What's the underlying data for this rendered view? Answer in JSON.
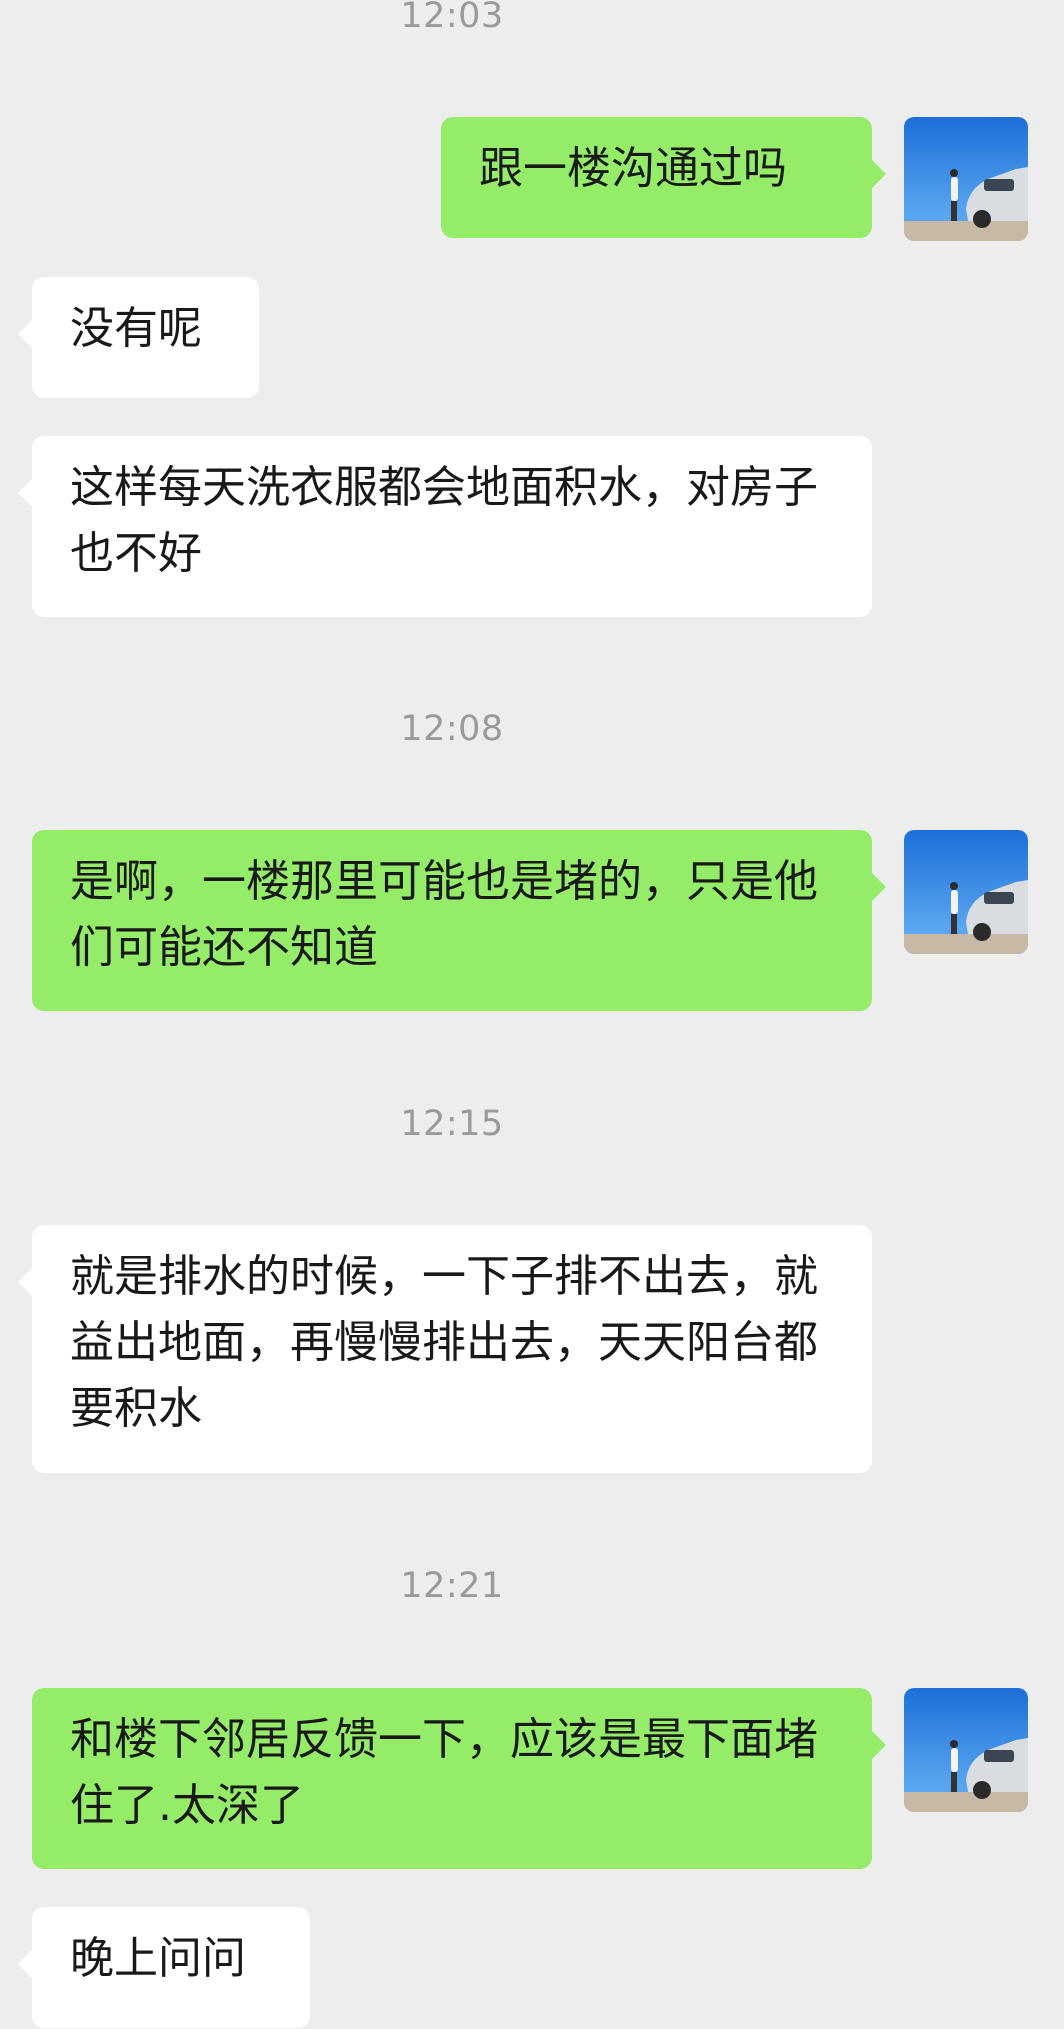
{
  "messages": [
    {
      "kind": "time",
      "text": "12:03"
    },
    {
      "kind": "out",
      "text": "跟一楼沟通过吗"
    },
    {
      "kind": "in",
      "text": "没有呢"
    },
    {
      "kind": "in",
      "text": "这样每天洗衣服都会地面积水，对房子也不好"
    },
    {
      "kind": "time",
      "text": "12:08"
    },
    {
      "kind": "out",
      "text": "是啊，一楼那里可能也是堵的，只是他们可能还不知道"
    },
    {
      "kind": "time",
      "text": "12:15"
    },
    {
      "kind": "in",
      "text": "就是排水的时候，一下子排不出去，就益出地面，再慢慢排出去，天天阳台都要积水"
    },
    {
      "kind": "time",
      "text": "12:21"
    },
    {
      "kind": "out",
      "text": "和楼下邻居反馈一下，应该是最下面堵住了.太深了"
    },
    {
      "kind": "in",
      "text": "晚上问问"
    }
  ],
  "avatar": {
    "icon": "avatar-photo-car-sky"
  },
  "colors": {
    "background": "#ededed",
    "outgoing_bubble": "#95ec69",
    "incoming_bubble": "#ffffff",
    "timestamp": "#9a9a9a"
  }
}
